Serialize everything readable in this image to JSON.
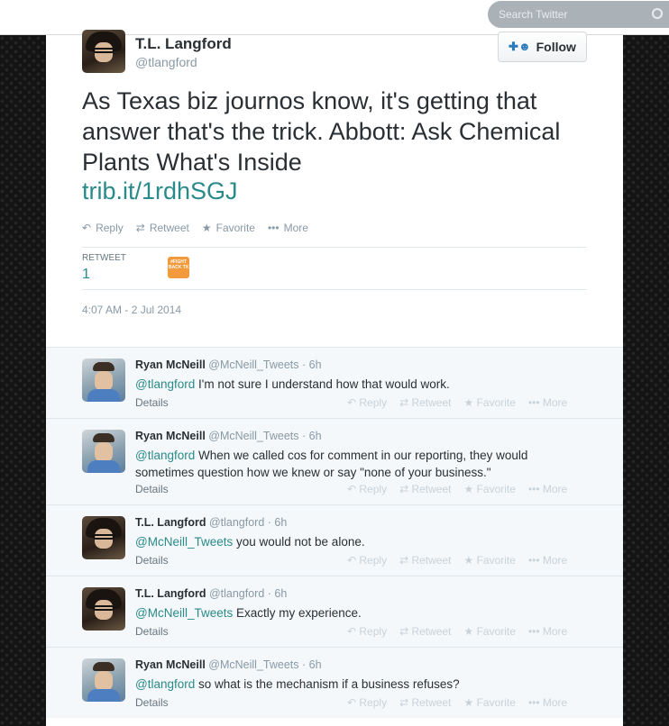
{
  "search": {
    "placeholder": "Search Twitter"
  },
  "tweet": {
    "author_name": "T.L. Langford",
    "author_handle": "@tlangford",
    "follow_label": "Follow",
    "text": "As Texas biz journos know, it's getting that answer that's the trick. Abbott: Ask Chemical Plants What's Inside",
    "link": "trib.it/1rdhSGJ",
    "actions": {
      "reply": "Reply",
      "retweet": "Retweet",
      "favorite": "Favorite",
      "more": "More"
    },
    "stat_label": "RETWEET",
    "stat_value": "1",
    "retweeter_badge": "#FIGHT BACK TX",
    "timestamp": "4:07 AM - 2 Jul 2014"
  },
  "reply_actions": {
    "reply": "Reply",
    "retweet": "Retweet",
    "favorite": "Favorite",
    "more": "More",
    "details": "Details"
  },
  "replies": [
    {
      "name": "Ryan McNeill",
      "meta": "@McNeill_Tweets · 6h",
      "mention": "@tlangford",
      "text": " I'm not sure I understand how that would work."
    },
    {
      "name": "Ryan McNeill",
      "meta": "@McNeill_Tweets · 6h",
      "mention": "@tlangford",
      "text": " When we called cos for comment in our reporting, they would sometimes question how we knew or say \"none of your business.\""
    },
    {
      "name": "T.L. Langford",
      "meta": "@tlangford · 6h",
      "mention": "@McNeill_Tweets",
      "text": " you would not be alone."
    },
    {
      "name": "T.L. Langford",
      "meta": "@tlangford · 6h",
      "mention": "@McNeill_Tweets",
      "text": " Exactly my experience."
    },
    {
      "name": "Ryan McNeill",
      "meta": "@McNeill_Tweets · 6h",
      "mention": "@tlangford",
      "text": " so what is the mechanism if a business refuses?"
    }
  ]
}
